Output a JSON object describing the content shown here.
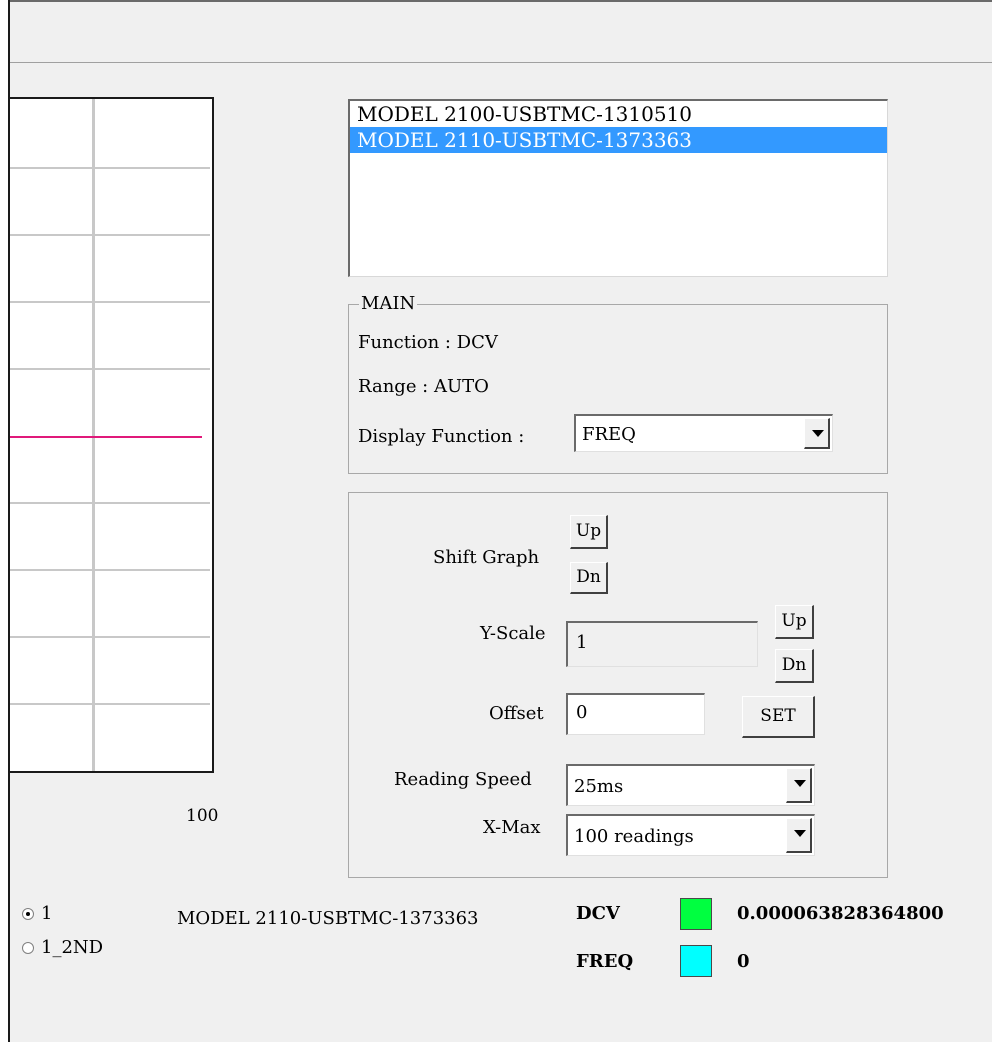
{
  "graph": {
    "x_max_label": "100"
  },
  "devices": {
    "items": [
      "MODEL 2100-USBTMC-1310510",
      "MODEL 2110-USBTMC-1373363"
    ],
    "selected_index": 1
  },
  "main": {
    "title": "MAIN",
    "function_label": "Function : DCV",
    "range_label": "Range : AUTO",
    "display_function_label": "Display Function :",
    "display_function_value": "FREQ"
  },
  "controls": {
    "shift_graph_label": "Shift Graph",
    "up": "Up",
    "dn": "Dn",
    "yscale_label": "Y-Scale",
    "yscale_value": "1",
    "offset_label": "Offset",
    "offset_value": "0",
    "set": "SET",
    "reading_speed_label": "Reading Speed",
    "reading_speed_value": "25ms",
    "xmax_label": "X-Max",
    "xmax_value": "100 readings"
  },
  "channels": {
    "options": [
      "1",
      "1_2ND"
    ],
    "selected": "1"
  },
  "status": {
    "device": "MODEL 2110-USBTMC-1373363",
    "rows": [
      {
        "name": "DCV",
        "color": "#00ff40",
        "value": "0.000063828364800"
      },
      {
        "name": "FREQ",
        "color": "#00ffff",
        "value": "0"
      }
    ]
  }
}
